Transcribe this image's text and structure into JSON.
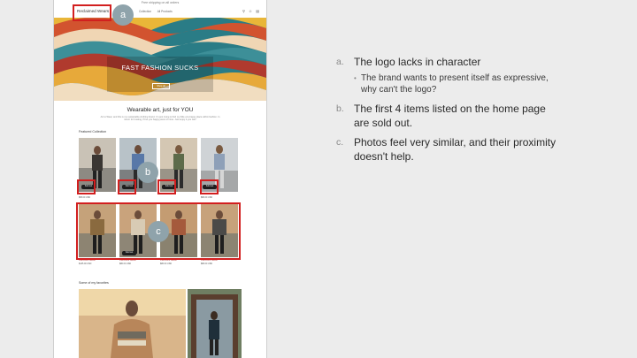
{
  "site": {
    "promo": "Free shipping on all orders",
    "logo": "Reclaimed Wears",
    "nav": [
      "Collection",
      "All Products"
    ],
    "icons": [
      "search-icon",
      "user-icon",
      "cart-icon"
    ],
    "hero": {
      "title": "FAST FASHION SUCKS",
      "button": "Shop all"
    },
    "section": {
      "heading": "Wearable art, just for YOU",
      "text": "Art to Wear, and this is my sustainable clothing brand. I'm just trying to find my little eco-happy place within fashion. In return for trusting, I'll let you happy piece of mine. Just enjoy it you can!"
    },
    "featured_label": "Featured Collection",
    "products": [
      {
        "name": "",
        "price": "$65.00 USD",
        "sold_out": true
      },
      {
        "name": "",
        "price": "",
        "sold_out": true
      },
      {
        "name": "",
        "price": "",
        "sold_out": true
      },
      {
        "name": "",
        "price": "$80.00 USD",
        "sold_out": true
      },
      {
        "name": "Patchwork Jacket",
        "price": "$135.00 USD",
        "sold_out": false
      },
      {
        "name": "Patchwork Jacket",
        "price": "$80.00 USD",
        "sold_out": true
      },
      {
        "name": "Patchwork Jacket",
        "price": "$80.00 USD",
        "sold_out": false
      },
      {
        "name": "Patchwork Jacket",
        "price": "$80.00 USD",
        "sold_out": false
      }
    ],
    "sold_out_label": "Sold out",
    "favorites_label": "Some of my favorites"
  },
  "badges": {
    "a": "a",
    "b": "b",
    "c": "c"
  },
  "notes": {
    "a_marker": "a.",
    "a_text": "The logo lacks in character",
    "a_sub": "The brand wants to present itself as expressive, why can't the logo?",
    "b_marker": "b.",
    "b_text": "The first 4 items listed on the home page are sold out.",
    "c_marker": "c.",
    "c_text": "Photos feel very similar, and their proximity doesn't help."
  },
  "colors": {
    "annotation_red": "#d21f1f",
    "badge": "#8fa3ab"
  }
}
